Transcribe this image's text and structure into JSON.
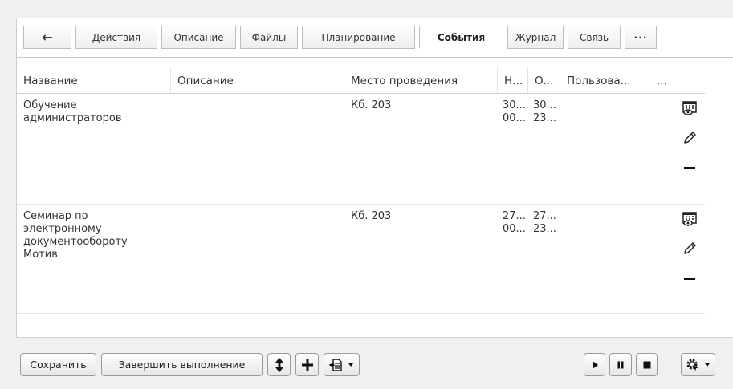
{
  "tabs": [
    {
      "id": "back",
      "label": "←"
    },
    {
      "id": "actions",
      "label": "Действия"
    },
    {
      "id": "description",
      "label": "Описание"
    },
    {
      "id": "files",
      "label": "Файлы"
    },
    {
      "id": "planning",
      "label": "Планирование"
    },
    {
      "id": "events",
      "label": "События"
    },
    {
      "id": "journal",
      "label": "Журнал"
    },
    {
      "id": "link",
      "label": "Связь"
    },
    {
      "id": "more",
      "label": "···"
    }
  ],
  "table": {
    "columns": [
      "Название",
      "Описание",
      "Место проведения",
      "Н...",
      "О...",
      "Пользова...",
      "..."
    ],
    "rows": [
      {
        "name": "Обучение администраторов",
        "description": "",
        "place": "Кб. 203",
        "start": "30...\n00...",
        "end": "30...\n23...",
        "user": ""
      },
      {
        "name": "Семинар по электронному документообороту Мотив",
        "description": "",
        "place": "Кб. 203",
        "start": "27...\n00...",
        "end": "27...\n23...",
        "user": ""
      }
    ],
    "row_actions": [
      "view-calendar-icon",
      "edit-pencil-icon",
      "remove-minus-icon"
    ]
  },
  "footer": {
    "save_label": "Сохранить",
    "complete_label": "Завершить выполнение",
    "icons": [
      "reorder-arrows-icon",
      "add-plus-icon",
      "document-add-icon",
      "play-icon",
      "pause-icon",
      "stop-icon",
      "gear-settings-icon"
    ]
  }
}
